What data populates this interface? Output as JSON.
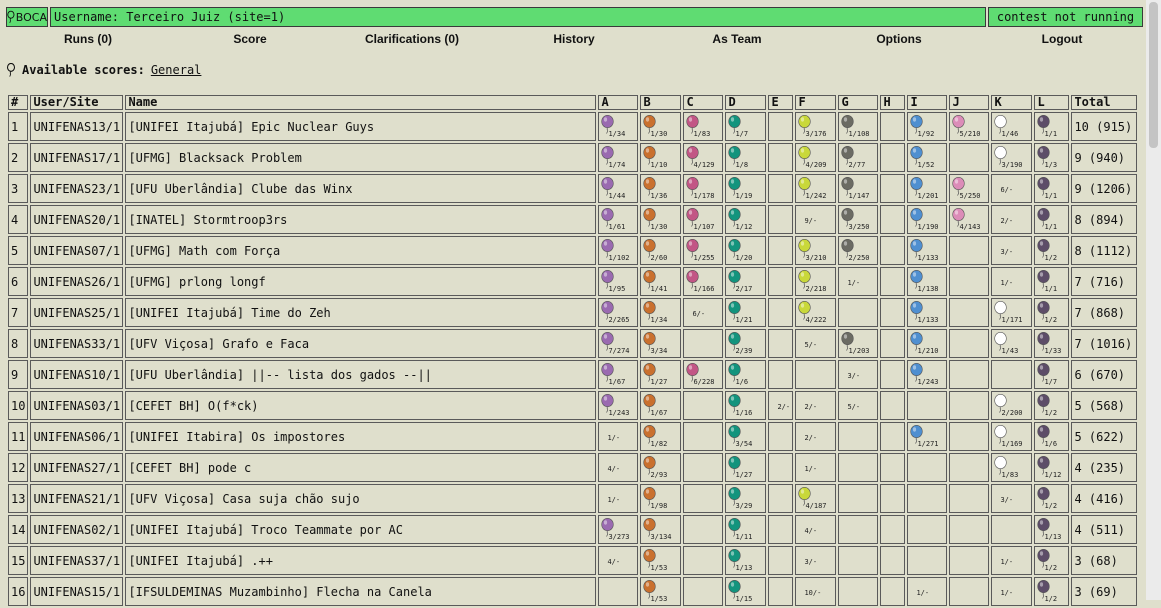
{
  "header": {
    "logo_text": "BOCA",
    "user_text": "Username: Terceiro Juiz (site=1)",
    "status_text": "contest not running"
  },
  "menu": [
    {
      "label": "Runs (0)",
      "key": "runs"
    },
    {
      "label": "Score",
      "key": "score"
    },
    {
      "label": "Clarifications (0)",
      "key": "clarifications"
    },
    {
      "label": "History",
      "key": "history"
    },
    {
      "label": "As Team",
      "key": "as-team"
    },
    {
      "label": "Options",
      "key": "options"
    },
    {
      "label": "Logout",
      "key": "logout"
    }
  ],
  "available_scores": {
    "label": "Available scores:",
    "link": "General"
  },
  "columns": {
    "num": "#",
    "user": "User/Site",
    "name": "Name",
    "total": "Total"
  },
  "problems": [
    "A",
    "B",
    "C",
    "D",
    "E",
    "F",
    "G",
    "H",
    "I",
    "J",
    "K",
    "L"
  ],
  "balloon_colors": {
    "A": "#9a6ab0",
    "B": "#c9702e",
    "C": "#c25685",
    "D": "#13947d",
    "E": "#888888",
    "F": "#c9d83a",
    "G": "#6b6b63",
    "H": "#888888",
    "I": "#4f8fd0",
    "J": "#dc8cb8",
    "K": "#ffffff",
    "L": "#5d4d68"
  },
  "rows": [
    {
      "rank": "1",
      "user": "UNIFENAS13/1",
      "name": "[UNIFEI Itajubá] Epic Nuclear Guys",
      "total": "10 (915)",
      "cells": [
        {
          "t": "1/34",
          "b": true
        },
        {
          "t": "1/30",
          "b": true
        },
        {
          "t": "1/83",
          "b": true
        },
        {
          "t": "1/7",
          "b": true
        },
        null,
        {
          "t": "3/176",
          "b": true
        },
        {
          "t": "1/108",
          "b": true
        },
        null,
        {
          "t": "1/92",
          "b": true
        },
        {
          "t": "5/210",
          "b": true
        },
        {
          "t": "1/46",
          "b": true
        },
        {
          "t": "1/1",
          "b": true
        }
      ]
    },
    {
      "rank": "2",
      "user": "UNIFENAS17/1",
      "name": "[UFMG] Blacksack Problem",
      "total": "9 (940)",
      "cells": [
        {
          "t": "1/74",
          "b": true
        },
        {
          "t": "1/10",
          "b": true
        },
        {
          "t": "4/129",
          "b": true
        },
        {
          "t": "1/8",
          "b": true
        },
        null,
        {
          "t": "4/209",
          "b": true
        },
        {
          "t": "2/77",
          "b": true
        },
        null,
        {
          "t": "1/52",
          "b": true
        },
        null,
        {
          "t": "3/190",
          "b": true
        },
        {
          "t": "1/3",
          "b": true
        }
      ]
    },
    {
      "rank": "3",
      "user": "UNIFENAS23/1",
      "name": "[UFU Uberlândia] Clube das Winx",
      "total": "9 (1206)",
      "cells": [
        {
          "t": "1/44",
          "b": true
        },
        {
          "t": "1/36",
          "b": true
        },
        {
          "t": "1/178",
          "b": true
        },
        {
          "t": "1/19",
          "b": true
        },
        null,
        {
          "t": "1/242",
          "b": true
        },
        {
          "t": "1/147",
          "b": true
        },
        null,
        {
          "t": "1/201",
          "b": true
        },
        {
          "t": "5/250",
          "b": true
        },
        {
          "t": "6/-",
          "b": false
        },
        {
          "t": "1/1",
          "b": true
        }
      ]
    },
    {
      "rank": "4",
      "user": "UNIFENAS20/1",
      "name": "[INATEL] Stormtroop3rs",
      "total": "8 (894)",
      "cells": [
        {
          "t": "1/61",
          "b": true
        },
        {
          "t": "1/30",
          "b": true
        },
        {
          "t": "1/107",
          "b": true
        },
        {
          "t": "1/12",
          "b": true
        },
        null,
        {
          "t": "9/-",
          "b": false
        },
        {
          "t": "3/250",
          "b": true
        },
        null,
        {
          "t": "1/190",
          "b": true
        },
        {
          "t": "4/143",
          "b": true
        },
        {
          "t": "2/-",
          "b": false
        },
        {
          "t": "1/1",
          "b": true
        }
      ]
    },
    {
      "rank": "5",
      "user": "UNIFENAS07/1",
      "name": "[UFMG] Math com Força",
      "total": "8 (1112)",
      "cells": [
        {
          "t": "1/102",
          "b": true
        },
        {
          "t": "2/60",
          "b": true
        },
        {
          "t": "1/255",
          "b": true
        },
        {
          "t": "1/20",
          "b": true
        },
        null,
        {
          "t": "3/210",
          "b": true
        },
        {
          "t": "2/250",
          "b": true
        },
        null,
        {
          "t": "1/133",
          "b": true
        },
        null,
        {
          "t": "3/-",
          "b": false
        },
        {
          "t": "1/2",
          "b": true
        }
      ]
    },
    {
      "rank": "6",
      "user": "UNIFENAS26/1",
      "name": "[UFMG] prlong longf",
      "total": "7 (716)",
      "cells": [
        {
          "t": "1/95",
          "b": true
        },
        {
          "t": "1/41",
          "b": true
        },
        {
          "t": "1/166",
          "b": true
        },
        {
          "t": "2/17",
          "b": true
        },
        null,
        {
          "t": "2/218",
          "b": true
        },
        {
          "t": "1/-",
          "b": false
        },
        null,
        {
          "t": "1/138",
          "b": true
        },
        null,
        {
          "t": "1/-",
          "b": false
        },
        {
          "t": "1/1",
          "b": true
        }
      ]
    },
    {
      "rank": "7",
      "user": "UNIFENAS25/1",
      "name": "[UNIFEI Itajubá] Time do Zeh",
      "total": "7 (868)",
      "cells": [
        {
          "t": "2/265",
          "b": true
        },
        {
          "t": "1/34",
          "b": true
        },
        {
          "t": "6/-",
          "b": false
        },
        {
          "t": "1/21",
          "b": true
        },
        null,
        {
          "t": "4/222",
          "b": true
        },
        null,
        null,
        {
          "t": "1/133",
          "b": true
        },
        null,
        {
          "t": "1/171",
          "b": true
        },
        {
          "t": "1/2",
          "b": true
        }
      ]
    },
    {
      "rank": "8",
      "user": "UNIFENAS33/1",
      "name": "[UFV Viçosa] Grafo e Faca",
      "total": "7 (1016)",
      "cells": [
        {
          "t": "7/274",
          "b": true
        },
        {
          "t": "3/34",
          "b": true
        },
        null,
        {
          "t": "2/39",
          "b": true
        },
        null,
        {
          "t": "5/-",
          "b": false
        },
        {
          "t": "1/203",
          "b": true
        },
        null,
        {
          "t": "1/210",
          "b": true
        },
        null,
        {
          "t": "1/43",
          "b": true
        },
        {
          "t": "1/33",
          "b": true
        }
      ]
    },
    {
      "rank": "9",
      "user": "UNIFENAS10/1",
      "name": "[UFU Uberlândia] ||-- lista dos gados --||",
      "total": "6 (670)",
      "cells": [
        {
          "t": "1/67",
          "b": true
        },
        {
          "t": "1/27",
          "b": true
        },
        {
          "t": "6/228",
          "b": true
        },
        {
          "t": "1/6",
          "b": true
        },
        null,
        null,
        {
          "t": "3/-",
          "b": false
        },
        null,
        {
          "t": "1/243",
          "b": true
        },
        null,
        null,
        {
          "t": "1/7",
          "b": true
        }
      ]
    },
    {
      "rank": "10",
      "user": "UNIFENAS03/1",
      "name": "[CEFET BH] O(f*ck)",
      "total": "5 (568)",
      "cells": [
        {
          "t": "1/243",
          "b": true
        },
        {
          "t": "1/67",
          "b": true
        },
        null,
        {
          "t": "1/16",
          "b": true
        },
        {
          "t": "2/-",
          "b": false
        },
        {
          "t": "2/-",
          "b": false
        },
        {
          "t": "5/-",
          "b": false
        },
        null,
        null,
        null,
        {
          "t": "2/200",
          "b": true
        },
        {
          "t": "1/2",
          "b": true
        }
      ]
    },
    {
      "rank": "11",
      "user": "UNIFENAS06/1",
      "name": "[UNIFEI Itabira] Os impostores",
      "total": "5 (622)",
      "cells": [
        {
          "t": "1/-",
          "b": false
        },
        {
          "t": "1/82",
          "b": true
        },
        null,
        {
          "t": "3/54",
          "b": true
        },
        null,
        {
          "t": "2/-",
          "b": false
        },
        null,
        null,
        {
          "t": "1/271",
          "b": true
        },
        null,
        {
          "t": "1/169",
          "b": true
        },
        {
          "t": "1/6",
          "b": true
        }
      ]
    },
    {
      "rank": "12",
      "user": "UNIFENAS27/1",
      "name": "[CEFET BH] pode c",
      "total": "4 (235)",
      "cells": [
        {
          "t": "4/-",
          "b": false
        },
        {
          "t": "2/93",
          "b": true
        },
        null,
        {
          "t": "1/27",
          "b": true
        },
        null,
        {
          "t": "1/-",
          "b": false
        },
        null,
        null,
        null,
        null,
        {
          "t": "1/83",
          "b": true
        },
        {
          "t": "1/12",
          "b": true
        }
      ]
    },
    {
      "rank": "13",
      "user": "UNIFENAS21/1",
      "name": "[UFV Viçosa] Casa suja chão sujo",
      "total": "4 (416)",
      "cells": [
        {
          "t": "1/-",
          "b": false
        },
        {
          "t": "1/98",
          "b": true
        },
        null,
        {
          "t": "3/29",
          "b": true
        },
        null,
        {
          "t": "4/187",
          "b": true
        },
        null,
        null,
        null,
        null,
        {
          "t": "3/-",
          "b": false
        },
        {
          "t": "1/2",
          "b": true
        }
      ]
    },
    {
      "rank": "14",
      "user": "UNIFENAS02/1",
      "name": "[UNIFEI Itajubá] Troco Teammate por AC",
      "total": "4 (511)",
      "cells": [
        {
          "t": "3/273",
          "b": true
        },
        {
          "t": "3/134",
          "b": true
        },
        null,
        {
          "t": "1/11",
          "b": true
        },
        null,
        {
          "t": "4/-",
          "b": false
        },
        null,
        null,
        null,
        null,
        null,
        {
          "t": "1/13",
          "b": true
        }
      ]
    },
    {
      "rank": "15",
      "user": "UNIFENAS37/1",
      "name": "[UNIFEI Itajubá] .++",
      "total": "3 (68)",
      "cells": [
        {
          "t": "4/-",
          "b": false
        },
        {
          "t": "1/53",
          "b": true
        },
        null,
        {
          "t": "1/13",
          "b": true
        },
        null,
        {
          "t": "3/-",
          "b": false
        },
        null,
        null,
        null,
        null,
        {
          "t": "1/-",
          "b": false
        },
        {
          "t": "1/2",
          "b": true
        }
      ]
    },
    {
      "rank": "16",
      "user": "UNIFENAS15/1",
      "name": "[IFSULDEMINAS Muzambinho] Flecha na Canela",
      "total": "3 (69)",
      "cells": [
        null,
        {
          "t": "1/53",
          "b": true
        },
        null,
        {
          "t": "1/15",
          "b": true
        },
        null,
        {
          "t": "10/-",
          "b": false
        },
        null,
        null,
        {
          "t": "1/-",
          "b": false
        },
        null,
        {
          "t": "1/-",
          "b": false
        },
        {
          "t": "1/2",
          "b": true
        }
      ]
    }
  ]
}
